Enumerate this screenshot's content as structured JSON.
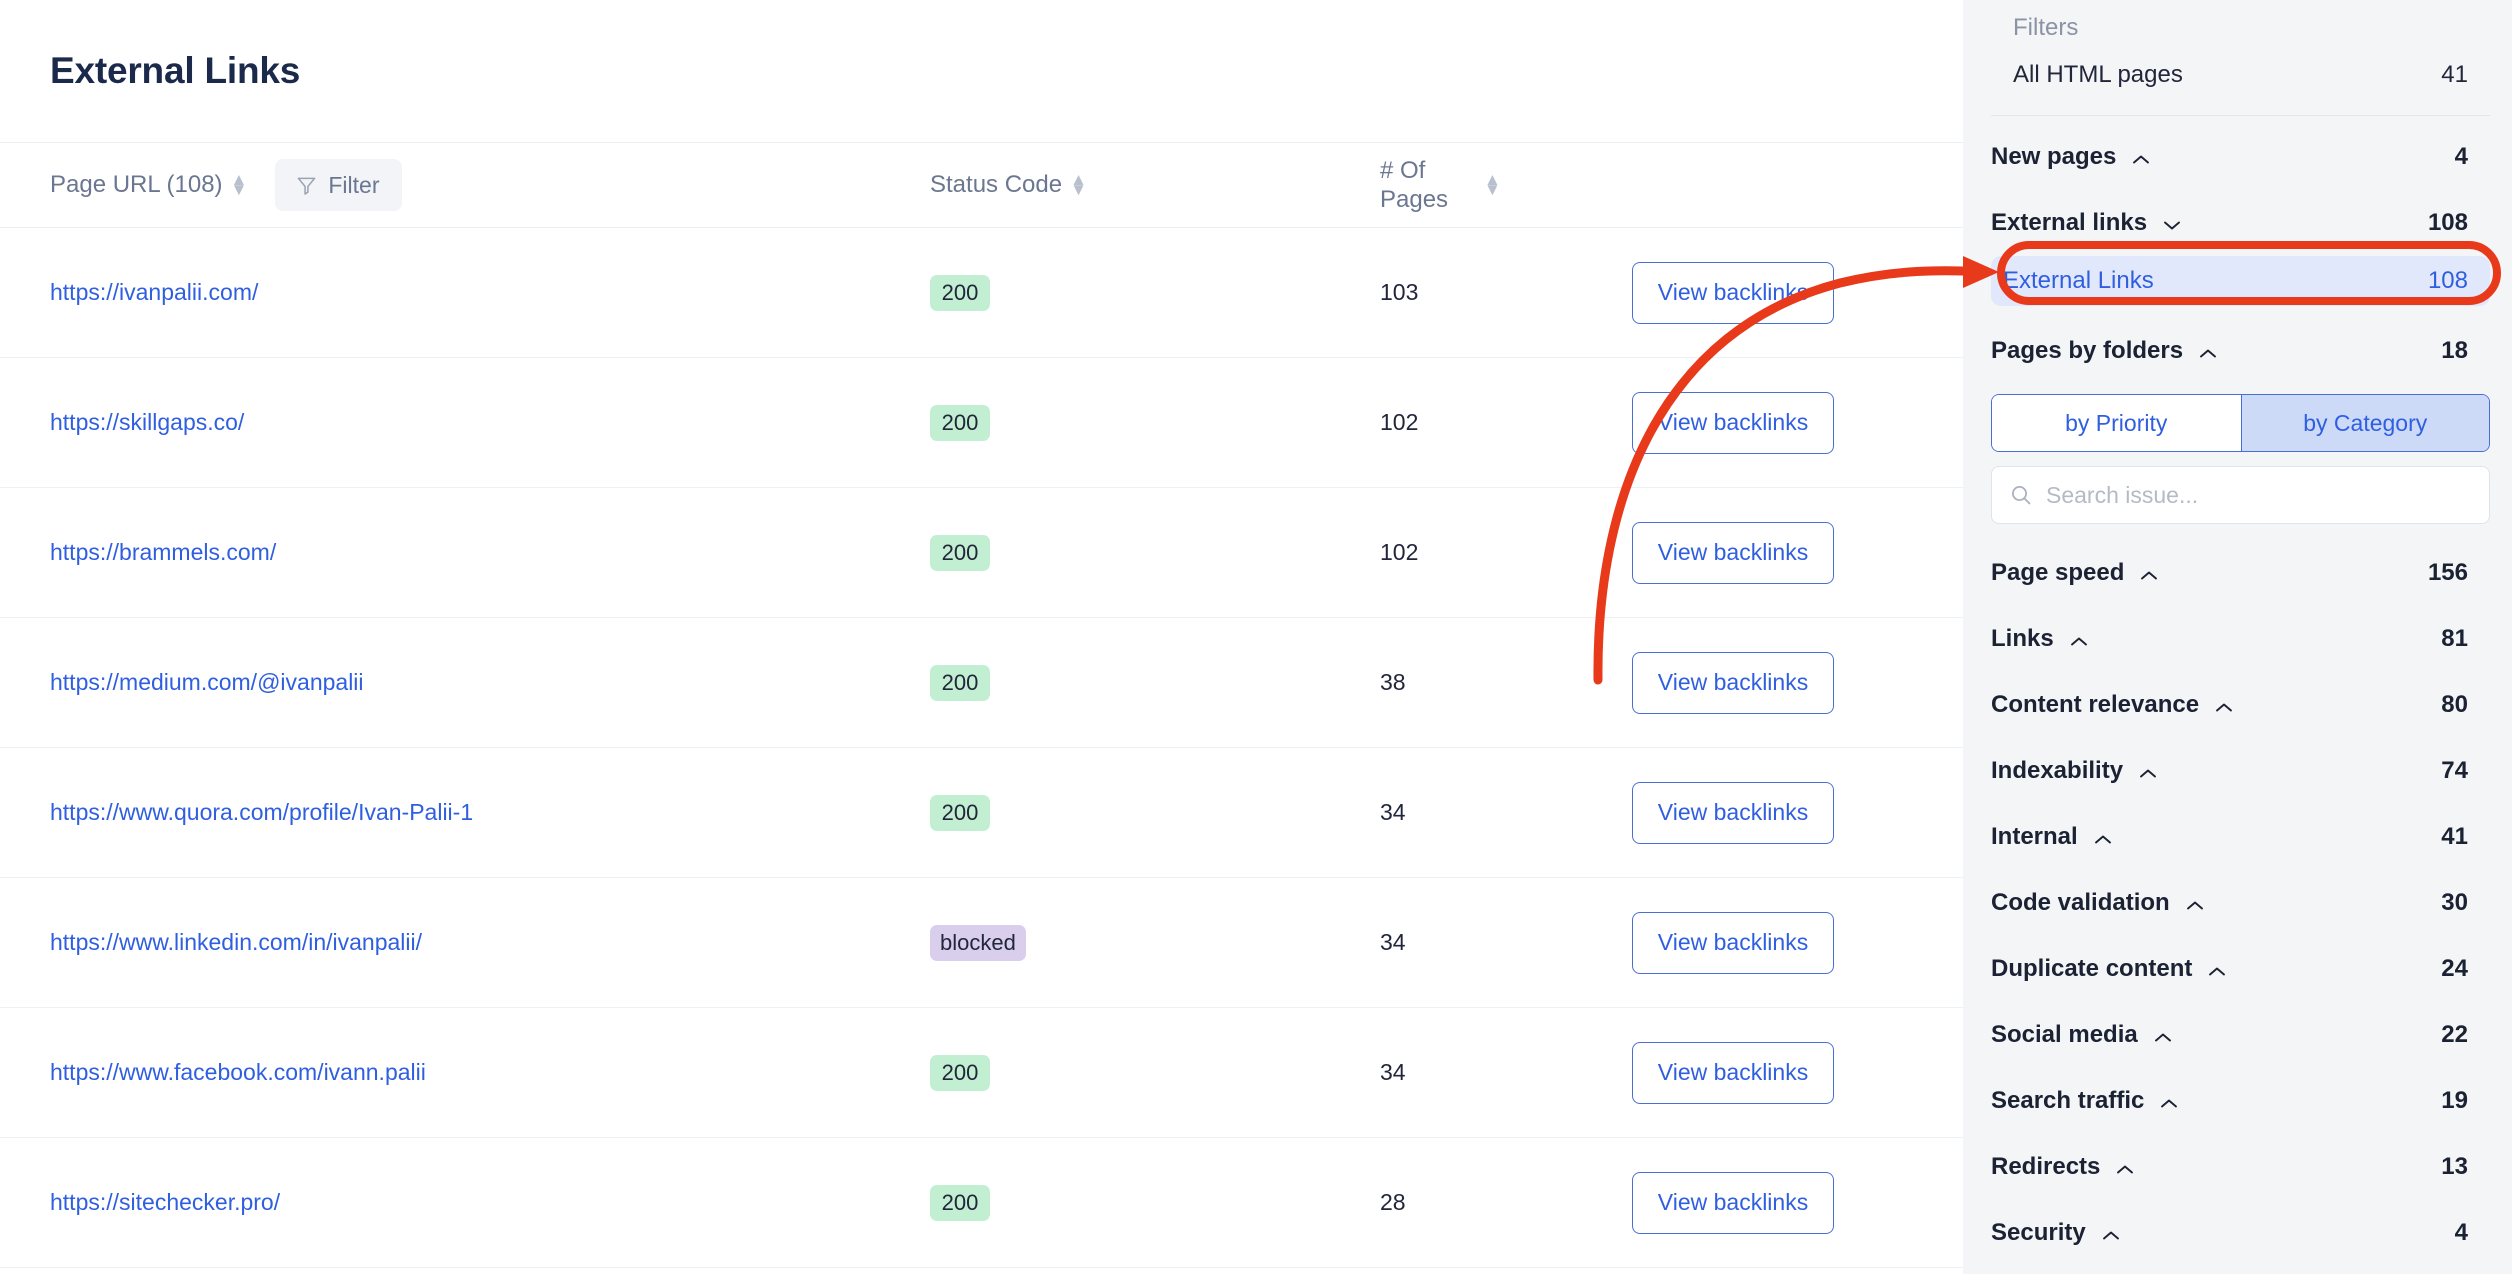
{
  "main": {
    "page_title": "External Links",
    "table": {
      "columns": [
        {
          "label": "Page URL (108)",
          "sortable": true
        },
        {
          "label": "Status Code",
          "sortable": true
        },
        {
          "label": "# Of Pages",
          "sortable": true
        },
        {
          "label": "",
          "sortable": false
        }
      ],
      "filter_button_label": "Filter",
      "action_label": "View backlinks",
      "rows": [
        {
          "url": "https://ivanpalii.com/",
          "status": "200",
          "status_type": "ok",
          "pages": "103"
        },
        {
          "url": "https://skillgaps.co/",
          "status": "200",
          "status_type": "ok",
          "pages": "102"
        },
        {
          "url": "https://brammels.com/",
          "status": "200",
          "status_type": "ok",
          "pages": "102"
        },
        {
          "url": "https://medium.com/@ivanpalii",
          "status": "200",
          "status_type": "ok",
          "pages": "38"
        },
        {
          "url": "https://www.quora.com/profile/Ivan-Palii-1",
          "status": "200",
          "status_type": "ok",
          "pages": "34"
        },
        {
          "url": "https://www.linkedin.com/in/ivanpalii/",
          "status": "blocked",
          "status_type": "blocked",
          "pages": "34"
        },
        {
          "url": "https://www.facebook.com/ivann.palii",
          "status": "200",
          "status_type": "ok",
          "pages": "34"
        },
        {
          "url": "https://sitechecker.pro/",
          "status": "200",
          "status_type": "ok",
          "pages": "28"
        }
      ]
    }
  },
  "sidebar": {
    "title": "Filters",
    "all_html_pages": {
      "label": "All HTML pages",
      "value": "41"
    },
    "new_pages": {
      "label": "New pages",
      "value": "4",
      "chevron": "chevron-up-icon"
    },
    "external_links": {
      "label": "External links",
      "value": "108",
      "chevron": "chevron-down-icon"
    },
    "external_links_sub": {
      "label": "External Links",
      "value": "108"
    },
    "pages_by_folders": {
      "label": "Pages by folders",
      "value": "18",
      "chevron": "chevron-up-icon"
    },
    "segmented": {
      "by_priority": "by Priority",
      "by_category": "by Category",
      "active": "by Category"
    },
    "search": {
      "placeholder": "Search issue..."
    },
    "groups": [
      {
        "label": "Page speed",
        "value": "156",
        "chevron": "chevron-up-icon"
      },
      {
        "label": "Links",
        "value": "81",
        "chevron": "chevron-up-icon"
      },
      {
        "label": "Content relevance",
        "value": "80",
        "chevron": "chevron-up-icon"
      },
      {
        "label": "Indexability",
        "value": "74",
        "chevron": "chevron-up-icon"
      },
      {
        "label": "Internal",
        "value": "41",
        "chevron": "chevron-up-icon"
      },
      {
        "label": "Code validation",
        "value": "30",
        "chevron": "chevron-up-icon"
      },
      {
        "label": "Duplicate content",
        "value": "24",
        "chevron": "chevron-up-icon"
      },
      {
        "label": "Social media",
        "value": "22",
        "chevron": "chevron-up-icon"
      },
      {
        "label": "Search traffic",
        "value": "19",
        "chevron": "chevron-up-icon"
      },
      {
        "label": "Redirects",
        "value": "13",
        "chevron": "chevron-up-icon"
      },
      {
        "label": "Security",
        "value": "4",
        "chevron": "chevron-up-icon"
      }
    ]
  },
  "annotation": {
    "color": "#E8391B",
    "arrow": "curved-arrow-annotation",
    "highlight": "rounded-rect-highlight"
  },
  "colors": {
    "link": "#2F5FE0",
    "status_ok_bg": "#C2EFD1",
    "status_blocked_bg": "#D9CFED",
    "sidebar_bg": "#F4F5F7",
    "annotation_red": "#E8391B"
  }
}
